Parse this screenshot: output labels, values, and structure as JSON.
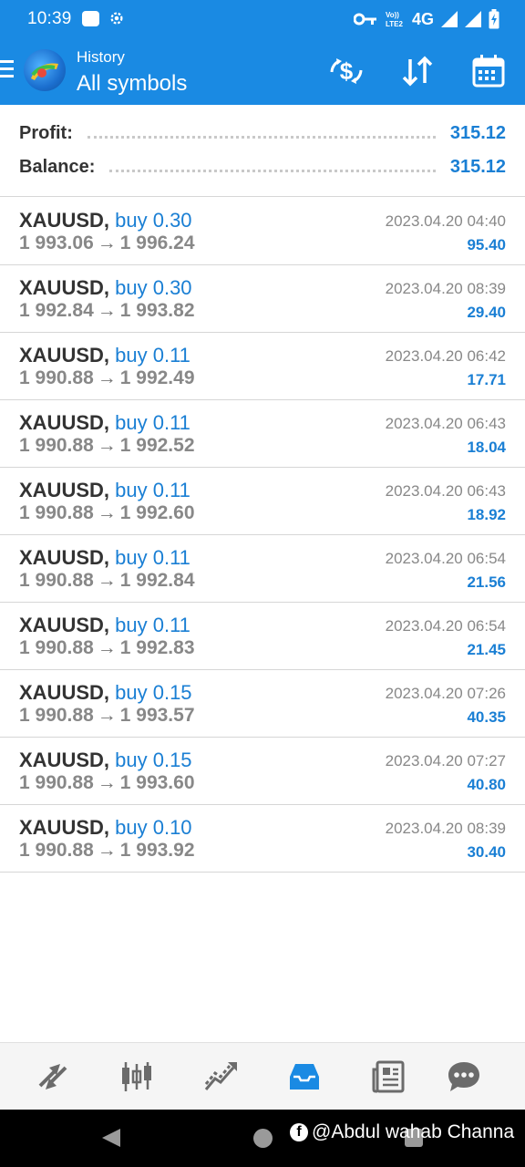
{
  "status_bar": {
    "time": "10:39",
    "network": "4G",
    "icons": [
      "key-icon",
      "volte-icon",
      "signal-icon",
      "battery-icon"
    ]
  },
  "header": {
    "title": "History",
    "subtitle": "All symbols",
    "icons": [
      "menu-icon",
      "app-logo",
      "deposit-icon",
      "sort-icon",
      "calendar-icon"
    ]
  },
  "summary": {
    "profit_label": "Profit:",
    "profit_value": "315.12",
    "balance_label": "Balance:",
    "balance_value": "315.12"
  },
  "deals": [
    {
      "symbol": "XAUUSD,",
      "type": "buy 0.30",
      "open": "1 993.06",
      "close": "1 996.24",
      "time": "2023.04.20 04:40",
      "profit": "95.40"
    },
    {
      "symbol": "XAUUSD,",
      "type": "buy 0.30",
      "open": "1 992.84",
      "close": "1 993.82",
      "time": "2023.04.20 08:39",
      "profit": "29.40"
    },
    {
      "symbol": "XAUUSD,",
      "type": "buy 0.11",
      "open": "1 990.88",
      "close": "1 992.49",
      "time": "2023.04.20 06:42",
      "profit": "17.71"
    },
    {
      "symbol": "XAUUSD,",
      "type": "buy 0.11",
      "open": "1 990.88",
      "close": "1 992.52",
      "time": "2023.04.20 06:43",
      "profit": "18.04"
    },
    {
      "symbol": "XAUUSD,",
      "type": "buy 0.11",
      "open": "1 990.88",
      "close": "1 992.60",
      "time": "2023.04.20 06:43",
      "profit": "18.92"
    },
    {
      "symbol": "XAUUSD,",
      "type": "buy 0.11",
      "open": "1 990.88",
      "close": "1 992.84",
      "time": "2023.04.20 06:54",
      "profit": "21.56"
    },
    {
      "symbol": "XAUUSD,",
      "type": "buy 0.11",
      "open": "1 990.88",
      "close": "1 992.83",
      "time": "2023.04.20 06:54",
      "profit": "21.45"
    },
    {
      "symbol": "XAUUSD,",
      "type": "buy 0.15",
      "open": "1 990.88",
      "close": "1 993.57",
      "time": "2023.04.20 07:26",
      "profit": "40.35"
    },
    {
      "symbol": "XAUUSD,",
      "type": "buy 0.15",
      "open": "1 990.88",
      "close": "1 993.60",
      "time": "2023.04.20 07:27",
      "profit": "40.80"
    },
    {
      "symbol": "XAUUSD,",
      "type": "buy 0.10",
      "open": "1 990.88",
      "close": "1 993.92",
      "time": "2023.04.20 08:39",
      "profit": "30.40"
    }
  ],
  "arrow": "→",
  "bottom_nav": {
    "items": [
      "quotes-icon",
      "chart-icon",
      "trade-icon",
      "history-icon",
      "news-icon",
      "chat-icon"
    ],
    "active": "history-icon"
  },
  "watermark": "@Abdul wahab Channa",
  "colors": {
    "header": "#1a8ae3",
    "accent": "#1a7fd4",
    "symbol": "#333333",
    "muted": "#888888"
  }
}
